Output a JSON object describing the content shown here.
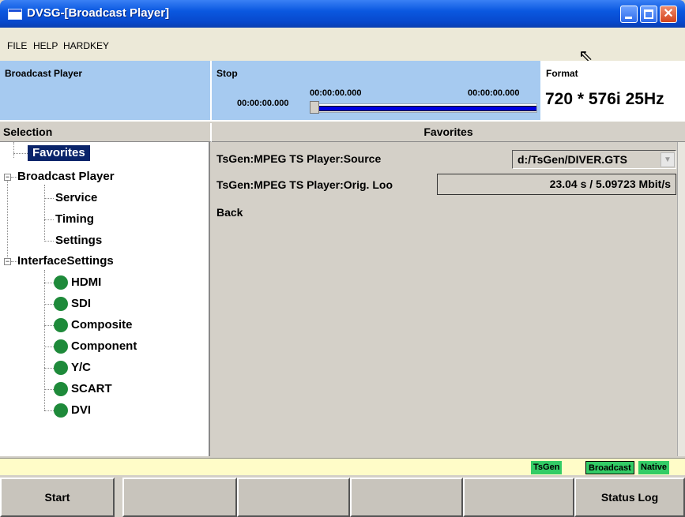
{
  "window": {
    "title": "DVSG-[Broadcast Player]"
  },
  "menu": [
    "FILE",
    "HELP",
    "HARDKEY"
  ],
  "header": {
    "panel_title": "Broadcast Player",
    "state": "Stop",
    "time_start": "00:00:00.000",
    "time_current": "00:00:00.000",
    "time_end": "00:00:00.000",
    "progress": 0,
    "format_label": "Format",
    "format_value": "720 * 576i 25Hz"
  },
  "selection_header": "Selection",
  "content_header": "Favorites",
  "tree": {
    "favorites": "Favorites",
    "broadcast_player": "Broadcast Player",
    "service": "Service",
    "timing": "Timing",
    "settings": "Settings",
    "interface_settings": "InterfaceSettings",
    "hdmi": "HDMI",
    "sdi": "SDI",
    "composite": "Composite",
    "component": "Component",
    "yc": "Y/C",
    "scart": "SCART",
    "dvi": "DVI"
  },
  "content": {
    "source_label": "TsGen:MPEG TS Player:Source",
    "source_value": "d:/TsGen/DIVER.GTS",
    "orig_label": "TsGen:MPEG TS Player:Orig. Loo",
    "orig_value": "23.04 s / 5.09723 Mbit/s",
    "back_label": "Back"
  },
  "status": {
    "tsgen": "TsGen",
    "broadcast": "Broadcast",
    "native": "Native",
    "color_green": "#33cc66"
  },
  "softkeys": [
    "Start",
    "",
    "",
    "",
    "",
    "Status Log"
  ],
  "icons": {
    "indicator": "green-circle-icon",
    "cursor": "mouse-pointer-icon"
  }
}
